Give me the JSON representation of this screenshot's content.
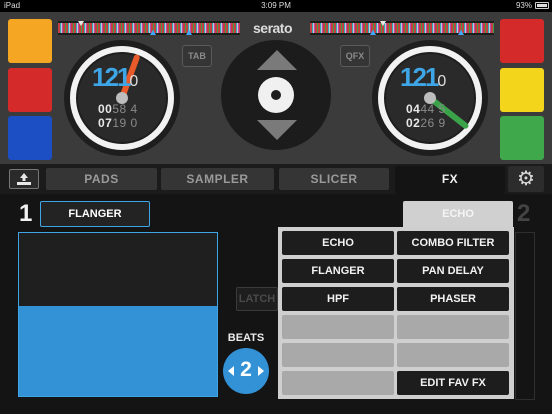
{
  "status_bar": {
    "device": "iPad",
    "time": "3:09 PM",
    "battery": "93%",
    "wifi_icon": "wifi-icon",
    "battery_icon": "battery-icon"
  },
  "header": {
    "logo": "serato",
    "tab_button": "TAB",
    "qfx_button": "QFX"
  },
  "colors": {
    "accent": "#3391d6",
    "pad_orange": "#f5a623",
    "pad_red": "#d42a2a",
    "pad_blue": "#1d4fc4",
    "pad_yellow": "#f3d51c",
    "pad_green": "#3ea84a",
    "deck1_needle": "#e85a2a",
    "deck2_needle": "#3aa34a"
  },
  "deck_left": {
    "bpm": "121",
    "bpm_fraction": "0",
    "time1_bright": "00",
    "time1_dim": "58 4",
    "time2_bright": "07",
    "time2_dim": "19 0"
  },
  "deck_right": {
    "bpm": "121",
    "bpm_fraction": "0",
    "time1_bright": "04",
    "time1_dim": "44 5",
    "time2_bright": "02",
    "time2_dim": "26 9"
  },
  "tabs": [
    "PADS",
    "SAMPLER",
    "SLICER",
    "FX"
  ],
  "active_tab": "FX",
  "fx": {
    "deck_left_number": "1",
    "deck_right_number": "2",
    "selected_effect": "FLANGER",
    "xy_level": 0.55,
    "latch_label": "LATCH",
    "beats_label": "BEATS",
    "beats_value": "2",
    "panel_tab": "ECHO",
    "effects": [
      "ECHO",
      "COMBO FILTER",
      "FLANGER",
      "PAN DELAY",
      "HPF",
      "PHASER",
      "",
      "",
      "",
      "",
      "",
      "EDIT FAV FX"
    ]
  }
}
